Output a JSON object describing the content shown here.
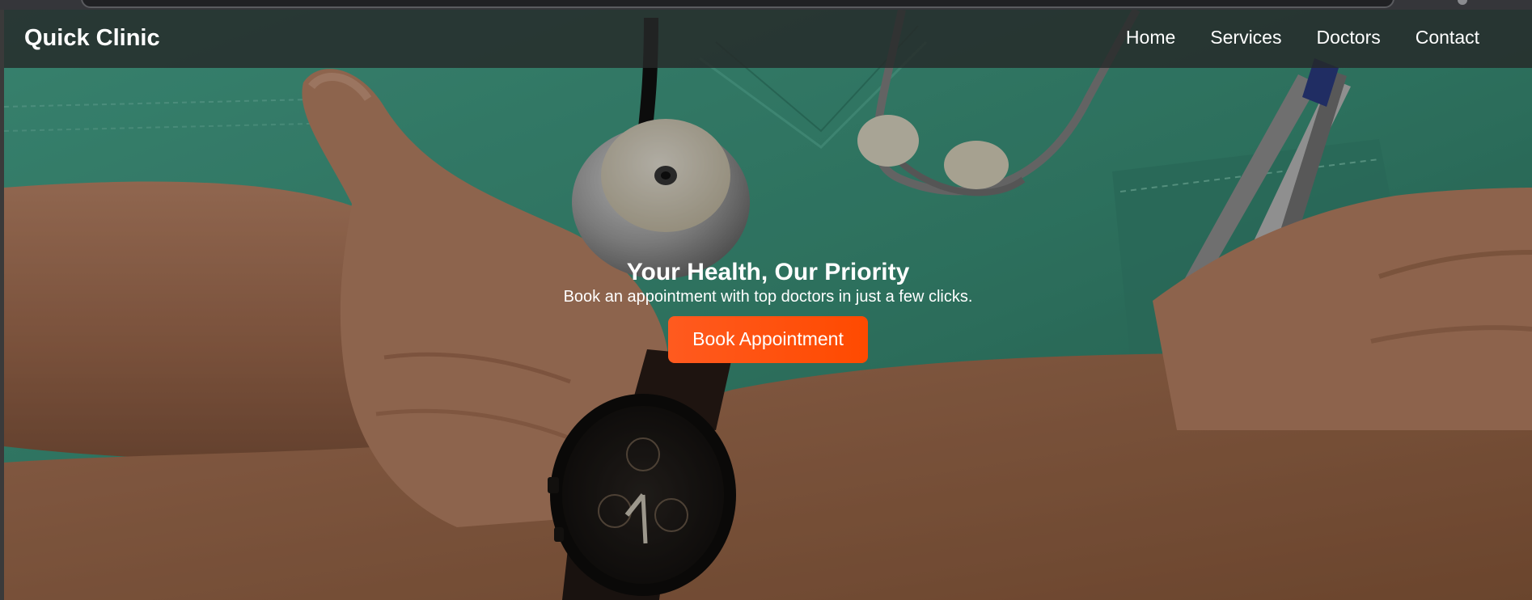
{
  "site": {
    "brand": "Quick Clinic"
  },
  "nav": {
    "items": [
      {
        "label": "Home"
      },
      {
        "label": "Services"
      },
      {
        "label": "Doctors"
      },
      {
        "label": "Contact"
      }
    ]
  },
  "hero": {
    "title": "Your Health, Our Priority",
    "subtitle": "Book an appointment with top doctors in just a few clicks.",
    "cta_label": "Book Appointment",
    "background_icon": "doctor-with-stethoscope-photo"
  },
  "colors": {
    "navbar": "#262828",
    "accent": "#ff5a1f",
    "scrubs": "#3f9c82",
    "skin": "#b07a5c"
  }
}
